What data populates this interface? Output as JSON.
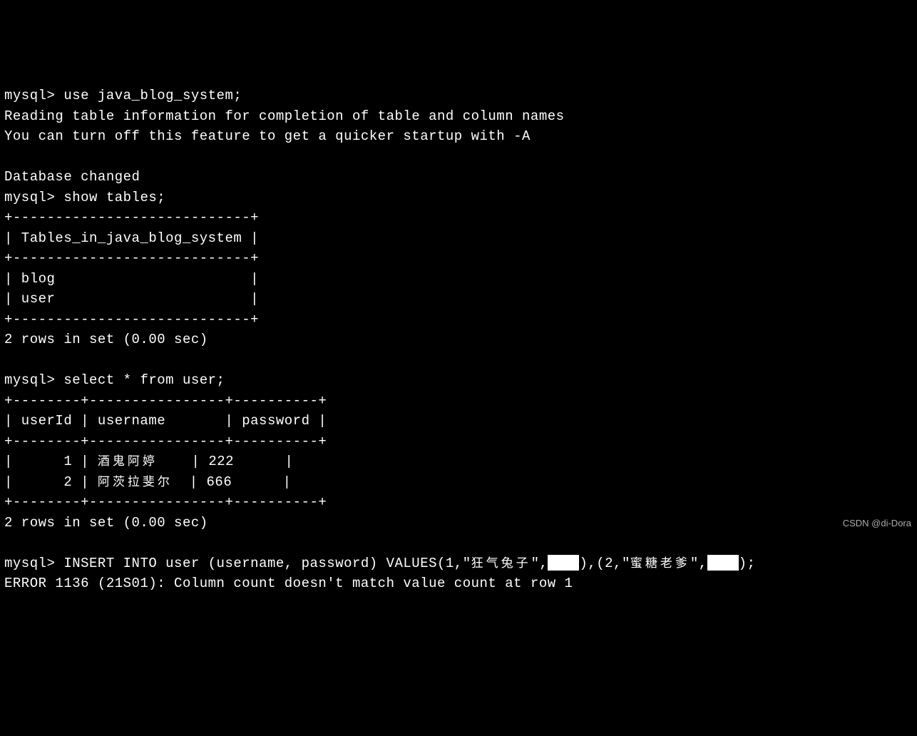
{
  "prompt": "mysql> ",
  "cmd1": "use java_blog_system;",
  "msg1": "Reading table information for completion of table and column names",
  "msg2": "You can turn off this feature to get a quicker startup with -A",
  "msg3": "Database changed",
  "cmd2": "show tables;",
  "tables_border_top": "+----------------------------+",
  "tables_header": "| Tables_in_java_blog_system |",
  "tables_border_mid": "+----------------------------+",
  "tables_row1": "| blog                       |",
  "tables_row2": "| user                       |",
  "tables_border_bot": "+----------------------------+",
  "rows_msg": "2 rows in set (0.00 sec)",
  "cmd3": "select * from user;",
  "user_border_top": "+--------+----------------+----------+",
  "user_header": "| userId | username       | password |",
  "user_border_mid": "+--------+----------------+----------+",
  "user_row1_a": "|      1 | ",
  "user_row1_name": "酒鬼阿婷",
  "user_row1_b": "    | 222      |",
  "user_row2_a": "|      2 | ",
  "user_row2_name": "阿茨拉斐尔",
  "user_row2_b": "  | 666      |",
  "user_border_bot": "+--------+----------------+----------+",
  "rows_msg2": "2 rows in set (0.00 sec)",
  "cmd4_a": "INSERT INTO user (username, password) VALUES(1,\"",
  "cmd4_name1": "狂气兔子",
  "cmd4_b": "\",",
  "cmd4_c": "),(2,\"",
  "cmd4_name2": "蜜糖老爹",
  "cmd4_d": "\",",
  "cmd4_e": ");",
  "error": "ERROR 1136 (21S01): Column count doesn't match value count at row 1",
  "watermark": "CSDN @di-Dora"
}
